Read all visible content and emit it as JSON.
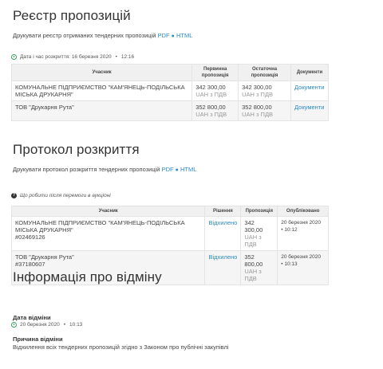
{
  "registry": {
    "title": "Реєстр пропозицій",
    "print_text": "Друкувати реєстр отриманих тендерних пропозицій",
    "pdf": "PDF",
    "dot": "●",
    "html": "HTML",
    "opened_label": "Дата і час розкриття: 16 березня 2020",
    "opened_sep": "•",
    "opened_time": "12:16",
    "headers": [
      "Учасник",
      "Первинна пропозиція",
      "Остаточна пропозиція",
      "Документи"
    ],
    "rows": [
      {
        "participant": "КОМУНАЛЬНЕ ПІДПРИЄМСТВО \"КАМ'ЯНЕЦЬ-ПОДІЛЬСЬКА МІСЬКА ДРУКАРНЯ\"",
        "initial": "342 300,00",
        "initial_vat": "UAH з ПДВ",
        "final": "342 300,00",
        "final_vat": "UAH з ПДВ",
        "docs": "Документи"
      },
      {
        "participant": "ТОВ \"Друкарня Рута\"",
        "initial": "352 800,00",
        "initial_vat": "UAH з ПДВ",
        "final": "352 800,00",
        "final_vat": "UAH з ПДВ",
        "docs": "Документи"
      }
    ]
  },
  "protocol": {
    "title": "Протокол розкриття",
    "print_text": "Друкувати протокол розкриття тендерних пропозицій",
    "pdf": "PDF",
    "dot": "●",
    "html": "HTML",
    "auction_note": "Що робити після перемоги в аукціоні",
    "headers": [
      "Учасник",
      "Рішення",
      "Пропозиція",
      "Опубліковано"
    ],
    "rows": [
      {
        "participant": "КОМУНАЛЬНЕ ПІДПРИЄМСТВО \"КАМ'ЯНЕЦЬ-ПОДІЛЬСЬКА МІСЬКА ДРУКАРНЯ\"",
        "code": "#02469126",
        "decision": "Відхилено",
        "offer": "342 300,00",
        "offer_vat": "UAH з ПДВ",
        "published_date": "20 березня 2020",
        "published_time": "• 10:12"
      },
      {
        "participant": "ТОВ \"Друкарня Рута\"",
        "code": "#37180607",
        "decision": "Відхилено",
        "offer": "352 800,00",
        "offer_vat": "UAH з ПДВ",
        "published_date": "20 березня 2020",
        "published_time": "• 10:13"
      }
    ]
  },
  "cancel": {
    "title": "Інформація про відміну",
    "date_label": "Дата відміни",
    "date_value": "20 березня 2020",
    "date_sep": "•",
    "date_time": "10:13",
    "reason_label": "Причина відміни",
    "reason_value": "Відхилення всіх тендерних пропозицій згідно з Законом про публічні закупівлі"
  },
  "colors": {
    "link": "#2a8bc7",
    "clock": "#3aa35b"
  }
}
